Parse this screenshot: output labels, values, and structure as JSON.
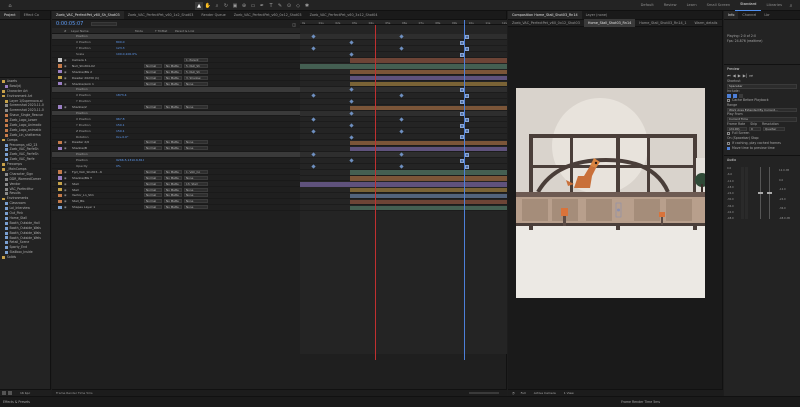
{
  "topbar": {
    "workspaces": [
      "Default",
      "Review",
      "Learn",
      "Small Screen",
      "Standard",
      "Libraries"
    ],
    "active_workspace": "Standard",
    "search_placeholder": "Search Help"
  },
  "project": {
    "tabs": [
      "Project",
      "Effect Co"
    ],
    "items": [
      {
        "name": "Assets",
        "kind": "folder",
        "color": "#c9a24a"
      },
      {
        "name": "Bowl(d)",
        "kind": "item",
        "color": "#9a7fc4"
      },
      {
        "name": "Character Art",
        "kind": "folder",
        "color": "#c9a24a"
      },
      {
        "name": "Environment Art",
        "kind": "folder",
        "color": "#c9a24a"
      },
      {
        "name": "Layer 1/Supernova.ai",
        "kind": "item",
        "color": "#c4a24a"
      },
      {
        "name": "Screenshot 2023-11-0",
        "kind": "item",
        "color": "#8a8a8a"
      },
      {
        "name": "Screenshot 2023-11-0",
        "kind": "item",
        "color": "#8a8a8a"
      },
      {
        "name": "Shaun_Single_Rescue",
        "kind": "item",
        "color": "#c47a4a"
      },
      {
        "name": "Zoeb_Logo_Lower",
        "kind": "item",
        "color": "#c47a4a"
      },
      {
        "name": "Zoeb_Logo_Animatic",
        "kind": "item",
        "color": "#c47a4a"
      },
      {
        "name": "Zoeb_Logo_animatic",
        "kind": "item",
        "color": "#c47a4a"
      },
      {
        "name": "Zoeb_Lin_shelterma",
        "kind": "item",
        "color": "#c47a4a"
      },
      {
        "name": "Comps",
        "kind": "folder",
        "color": "#c9a24a"
      },
      {
        "name": "Precomps_v62_23",
        "kind": "comp",
        "color": "#7a9fd0"
      },
      {
        "name": "Zoeb_VAC_ParfeSh",
        "kind": "comp",
        "color": "#7a9fd0"
      },
      {
        "name": "Zoeb_VAC_ParfeSh",
        "kind": "comp",
        "color": "#7a9fd0"
      },
      {
        "name": "Zoeb_VAC_Parfe",
        "kind": "comp",
        "color": "#7a9fd0"
      },
      {
        "name": "Precomps",
        "kind": "folder",
        "color": "#c9a24a"
      },
      {
        "name": "_MainComps",
        "kind": "folder",
        "color": "#c9a24a"
      },
      {
        "name": "Character_Sign",
        "kind": "item",
        "color": "#8a8a8a"
      },
      {
        "name": "DDR_WormedCamer",
        "kind": "item",
        "color": "#8a8a8a"
      },
      {
        "name": "Vendor",
        "kind": "item",
        "color": "#8a8a8a"
      },
      {
        "name": "VAC_ParfectHur",
        "kind": "item",
        "color": "#8a8a8a"
      },
      {
        "name": "Results",
        "kind": "item",
        "color": "#8a8a8a"
      },
      {
        "name": "Environments",
        "kind": "folder",
        "color": "#c9a24a"
      },
      {
        "name": "Classroom",
        "kind": "comp",
        "color": "#7a9fd0"
      },
      {
        "name": "Lol_Interview",
        "kind": "comp",
        "color": "#7a9fd0"
      },
      {
        "name": "Out_Pink",
        "kind": "comp",
        "color": "#7a9fd0"
      },
      {
        "name": "Home_Stall",
        "kind": "comp",
        "color": "#7a9fd0"
      },
      {
        "name": "Booth_Outside_Hall",
        "kind": "comp",
        "color": "#7a9fd0"
      },
      {
        "name": "Booth_Outside_Wals",
        "kind": "comp",
        "color": "#7a9fd0"
      },
      {
        "name": "Booth_Outside_Wals",
        "kind": "comp",
        "color": "#7a9fd0"
      },
      {
        "name": "Booth_Outside_Wels",
        "kind": "comp",
        "color": "#7a9fd0"
      },
      {
        "name": "Retail_Scene",
        "kind": "comp",
        "color": "#7a9fd0"
      },
      {
        "name": "Sporty_End",
        "kind": "comp",
        "color": "#7a9fd0"
      },
      {
        "name": "Stallbox_Inside",
        "kind": "comp",
        "color": "#7a9fd0"
      },
      {
        "name": "Solids",
        "kind": "folder",
        "color": "#c9a24a"
      }
    ],
    "bpc": "16 bpc"
  },
  "timeline": {
    "tabs": [
      "Zoeb_VAC_PerfectPet_v60_Sh_Shot03",
      "Zoeb_VAC_PerfectPet_v60_1x2_Shot03",
      "Render Queue",
      "Zoeb_VAC_PerfectPet_v60_0x12_Shot03",
      "Zoeb_VAC_PerfectPet_v60_3x12_Shot04"
    ],
    "timecode": "0:00:05:07",
    "columns": [
      "#",
      "Layer Name",
      "Mode",
      "T TrkMat",
      "Parent & Link"
    ],
    "layers": [
      {
        "num": "",
        "name": "Position",
        "val": "",
        "mode": "",
        "trk": "",
        "parent": "",
        "color": "#888",
        "sel": true,
        "sub": true
      },
      {
        "num": "",
        "name": "X Position",
        "val": "800.0",
        "mode": "",
        "trk": "",
        "parent": "",
        "color": "#888",
        "sub": true
      },
      {
        "num": "",
        "name": "Y Position",
        "val": "123.3",
        "mode": "",
        "trk": "",
        "parent": "",
        "color": "#888",
        "sub": true
      },
      {
        "num": "",
        "name": "Scale",
        "val": "100.0,100.0%",
        "mode": "",
        "trk": "",
        "parent": "",
        "color": "#888",
        "sub": true
      },
      {
        "num": "",
        "name": "Camera 1",
        "val": "",
        "mode": "",
        "trk": "",
        "parent": "1. Parent",
        "color": "#c4c4c4"
      },
      {
        "num": "",
        "name": "Null_Shot04-02",
        "val": "",
        "mode": "Normal",
        "trk": "No Matte",
        "parent": "5. Null_Sh",
        "color": "#c47a4a"
      },
      {
        "num": "",
        "name": "Shadow/BG 2",
        "val": "",
        "mode": "Normal",
        "trk": "No Matte",
        "parent": "5. Null_Sh",
        "color": "#9a7fc4"
      },
      {
        "num": "",
        "name": "Dweller 20230 (1)",
        "val": "",
        "mode": "Normal",
        "trk": "No Matte",
        "parent": "3. Shadow",
        "color": "#c4a24a"
      },
      {
        "num": "",
        "name": "Shadow/Link 1",
        "val": "",
        "mode": "Normal",
        "trk": "No Matte",
        "parent": "None",
        "color": "#9a7fc4"
      },
      {
        "num": "",
        "name": "Position",
        "val": "",
        "mode": "",
        "trk": "",
        "parent": "",
        "color": "#888",
        "sel": true,
        "sub": true
      },
      {
        "num": "",
        "name": "X Position",
        "val": "1873.4",
        "mode": "",
        "trk": "",
        "parent": "",
        "color": "#888",
        "sub": true
      },
      {
        "num": "",
        "name": "Y Position",
        "val": "",
        "mode": "",
        "trk": "",
        "parent": "",
        "color": "#888",
        "sub": true
      },
      {
        "num": "",
        "name": "Shadow/2",
        "val": "",
        "mode": "Normal",
        "trk": "No Matte",
        "parent": "None",
        "color": "#9a7fc4"
      },
      {
        "num": "",
        "name": "Position",
        "val": "",
        "mode": "",
        "trk": "",
        "parent": "",
        "color": "#888",
        "sel": true,
        "sub": true
      },
      {
        "num": "",
        "name": "X Position",
        "val": "967.8",
        "mode": "",
        "trk": "",
        "parent": "",
        "color": "#888",
        "sub": true
      },
      {
        "num": "",
        "name": "Y Position",
        "val": "150.1",
        "mode": "",
        "trk": "",
        "parent": "",
        "color": "#888",
        "sub": true
      },
      {
        "num": "",
        "name": "Z Position",
        "val": "150.1",
        "mode": "",
        "trk": "",
        "parent": "",
        "color": "#888",
        "sub": true
      },
      {
        "num": "",
        "name": "Rotation",
        "val": "0x+0.0°",
        "mode": "",
        "trk": "",
        "parent": "",
        "color": "#888",
        "sub": true
      },
      {
        "num": "",
        "name": "Dweller 2/0",
        "val": "",
        "mode": "Normal",
        "trk": "No Matte",
        "parent": "None",
        "color": "#c47a4a"
      },
      {
        "num": "",
        "name": "Shadow/B",
        "val": "",
        "mode": "Normal",
        "trk": "No Matte",
        "parent": "None",
        "color": "#9a7fc4"
      },
      {
        "num": "",
        "name": "Position",
        "val": "",
        "mode": "",
        "trk": "",
        "parent": "",
        "color": "#888",
        "sel": true,
        "sub": true
      },
      {
        "num": "",
        "name": "Position",
        "val": "9266.5,1310.6,8143",
        "mode": "",
        "trk": "",
        "parent": "",
        "color": "#888",
        "sub": true
      },
      {
        "num": "",
        "name": "Opacity",
        "val": "0%",
        "mode": "",
        "trk": "",
        "parent": "",
        "color": "#888",
        "sub": true
      },
      {
        "num": "",
        "name": "Fgd_VAC_Shot03...6",
        "val": "",
        "mode": "Normal",
        "trk": "No Matte",
        "parent": "1. VAC_Co",
        "color": "#c47a4a"
      },
      {
        "num": "",
        "name": "Shadow/BG T",
        "val": "",
        "mode": "Normal",
        "trk": "No Matte",
        "parent": "None",
        "color": "#9a7fc4"
      },
      {
        "num": "",
        "name": "Stall",
        "val": "",
        "mode": "Normal",
        "trk": "No Matte",
        "parent": "13. Stall",
        "color": "#c4a24a"
      },
      {
        "num": "",
        "name": "Stall",
        "val": "",
        "mode": "Normal",
        "trk": "No Matte",
        "parent": "None",
        "color": "#c4a24a"
      },
      {
        "num": "",
        "name": "Vector_Ln_Sh1",
        "val": "",
        "mode": "Normal",
        "trk": "No Matte",
        "parent": "None",
        "color": "#c47a4a"
      },
      {
        "num": "",
        "name": "Stall_BG",
        "val": "",
        "mode": "Normal",
        "trk": "No Matte",
        "parent": "None",
        "color": "#c47a4a"
      },
      {
        "num": "",
        "name": "Shapes Layer 1",
        "val": "",
        "mode": "Normal",
        "trk": "No Matte",
        "parent": "None",
        "color": "#7a9fd0"
      }
    ],
    "ruler": [
      "0s",
      "01s",
      "02s",
      "03s",
      "04s",
      "05s",
      "06s",
      "07s",
      "08s",
      "09s",
      "10s",
      "11s",
      "12s"
    ],
    "footer": "Frame Render Time 5ms"
  },
  "viewer": {
    "tabs": [
      "Composition Home_Stall_Shot03_Rn14",
      "Layer (none)"
    ],
    "sub_tabs": [
      "Zoeb_VAC_PerfectPet_v60_0x12_Shot03",
      "Home_Stall_Shot03_Rn14",
      "Home_Stall_Shot03_Rn14_1",
      "Warm_details"
    ],
    "controls": [
      "Full",
      "Active Camera",
      "1 View"
    ]
  },
  "right": {
    "info": {
      "title": "Info",
      "tabs": [
        "Info",
        "Channel",
        "Lbr"
      ],
      "lines": [
        "Playing: 2:0 of 2:0",
        "Fps: 24.876 (realtime)"
      ]
    },
    "preview": {
      "title": "Preview",
      "shortcut_label": "Shortcut",
      "shortcut": "Spacebar",
      "include_label": "Include:",
      "cache": "Cache Before Playback",
      "range_label": "Range",
      "range": "Work Area Extended By Current...",
      "play_from_label": "Play From",
      "play_from": "Current Time",
      "frame_rate_label": "Frame Rate",
      "skip_label": "Skip",
      "res_label": "Resolution",
      "frame_rate": "(24.00)",
      "skip": "0",
      "res": "Quarter",
      "full_screen": "Full Screen",
      "stop_label": "On (Spacebar) Stop:",
      "stop_opt1": "If caching, play cached frames",
      "stop_opt2": "Move time to preview time"
    },
    "audio": {
      "title": "Audio",
      "scale": [
        "0.0",
        "-6.0",
        "-12.0",
        "-18.0",
        "-24.0",
        "-30.0",
        "-36.0",
        "-42.0",
        "-48.0"
      ],
      "db": [
        "12.0 dB",
        "0.0",
        "-12.0",
        "-24.0",
        "-36.0",
        "-48.0 dB"
      ]
    }
  },
  "status": {
    "left": "Effects & Presets",
    "right": "Frame Render Time 5ms",
    "toggle": "Toggle Switches / Modes"
  }
}
